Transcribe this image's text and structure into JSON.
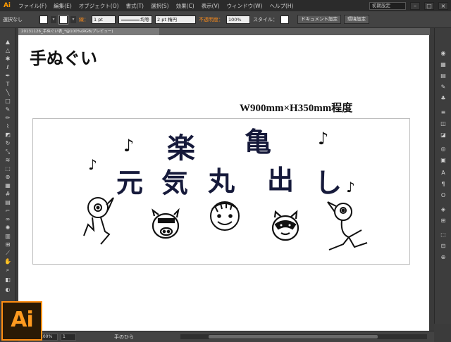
{
  "app": {
    "name": "Ai",
    "logo_text": "Ai"
  },
  "menu": {
    "items": [
      "ファイル(F)",
      "編集(E)",
      "オブジェクト(O)",
      "書式(T)",
      "選択(S)",
      "効果(C)",
      "表示(V)",
      "ウィンドウ(W)",
      "ヘルプ(H)"
    ],
    "workspace": "初期設定",
    "window_controls": [
      "–",
      "□",
      "×"
    ]
  },
  "control": {
    "selection": "選択なし",
    "stroke_label": "線：",
    "stroke_weight": "1 pt",
    "stroke_style": "均等",
    "brush": "2 pt 楕円",
    "opacity_label": "不透明度：",
    "opacity": "100%",
    "style_label": "スタイル：",
    "doc_setup": "ドキュメント設定",
    "prefs": "環境設定"
  },
  "document": {
    "tab_label": "20131126_手ぬぐい表_*@100%(RGB/プレビュー)",
    "title": "手ぬぐい",
    "size_label": "W900mm×H350mm程度"
  },
  "artwork": {
    "row1": [
      "楽",
      "亀"
    ],
    "row2": [
      "元",
      "気",
      "丸",
      "出",
      "し"
    ],
    "note": "♪"
  },
  "status": {
    "zoom": "100%",
    "page": "1",
    "tool_name": "手のひら"
  },
  "colors": {
    "accent": "#ff9a00",
    "ink": "#161a3b"
  }
}
